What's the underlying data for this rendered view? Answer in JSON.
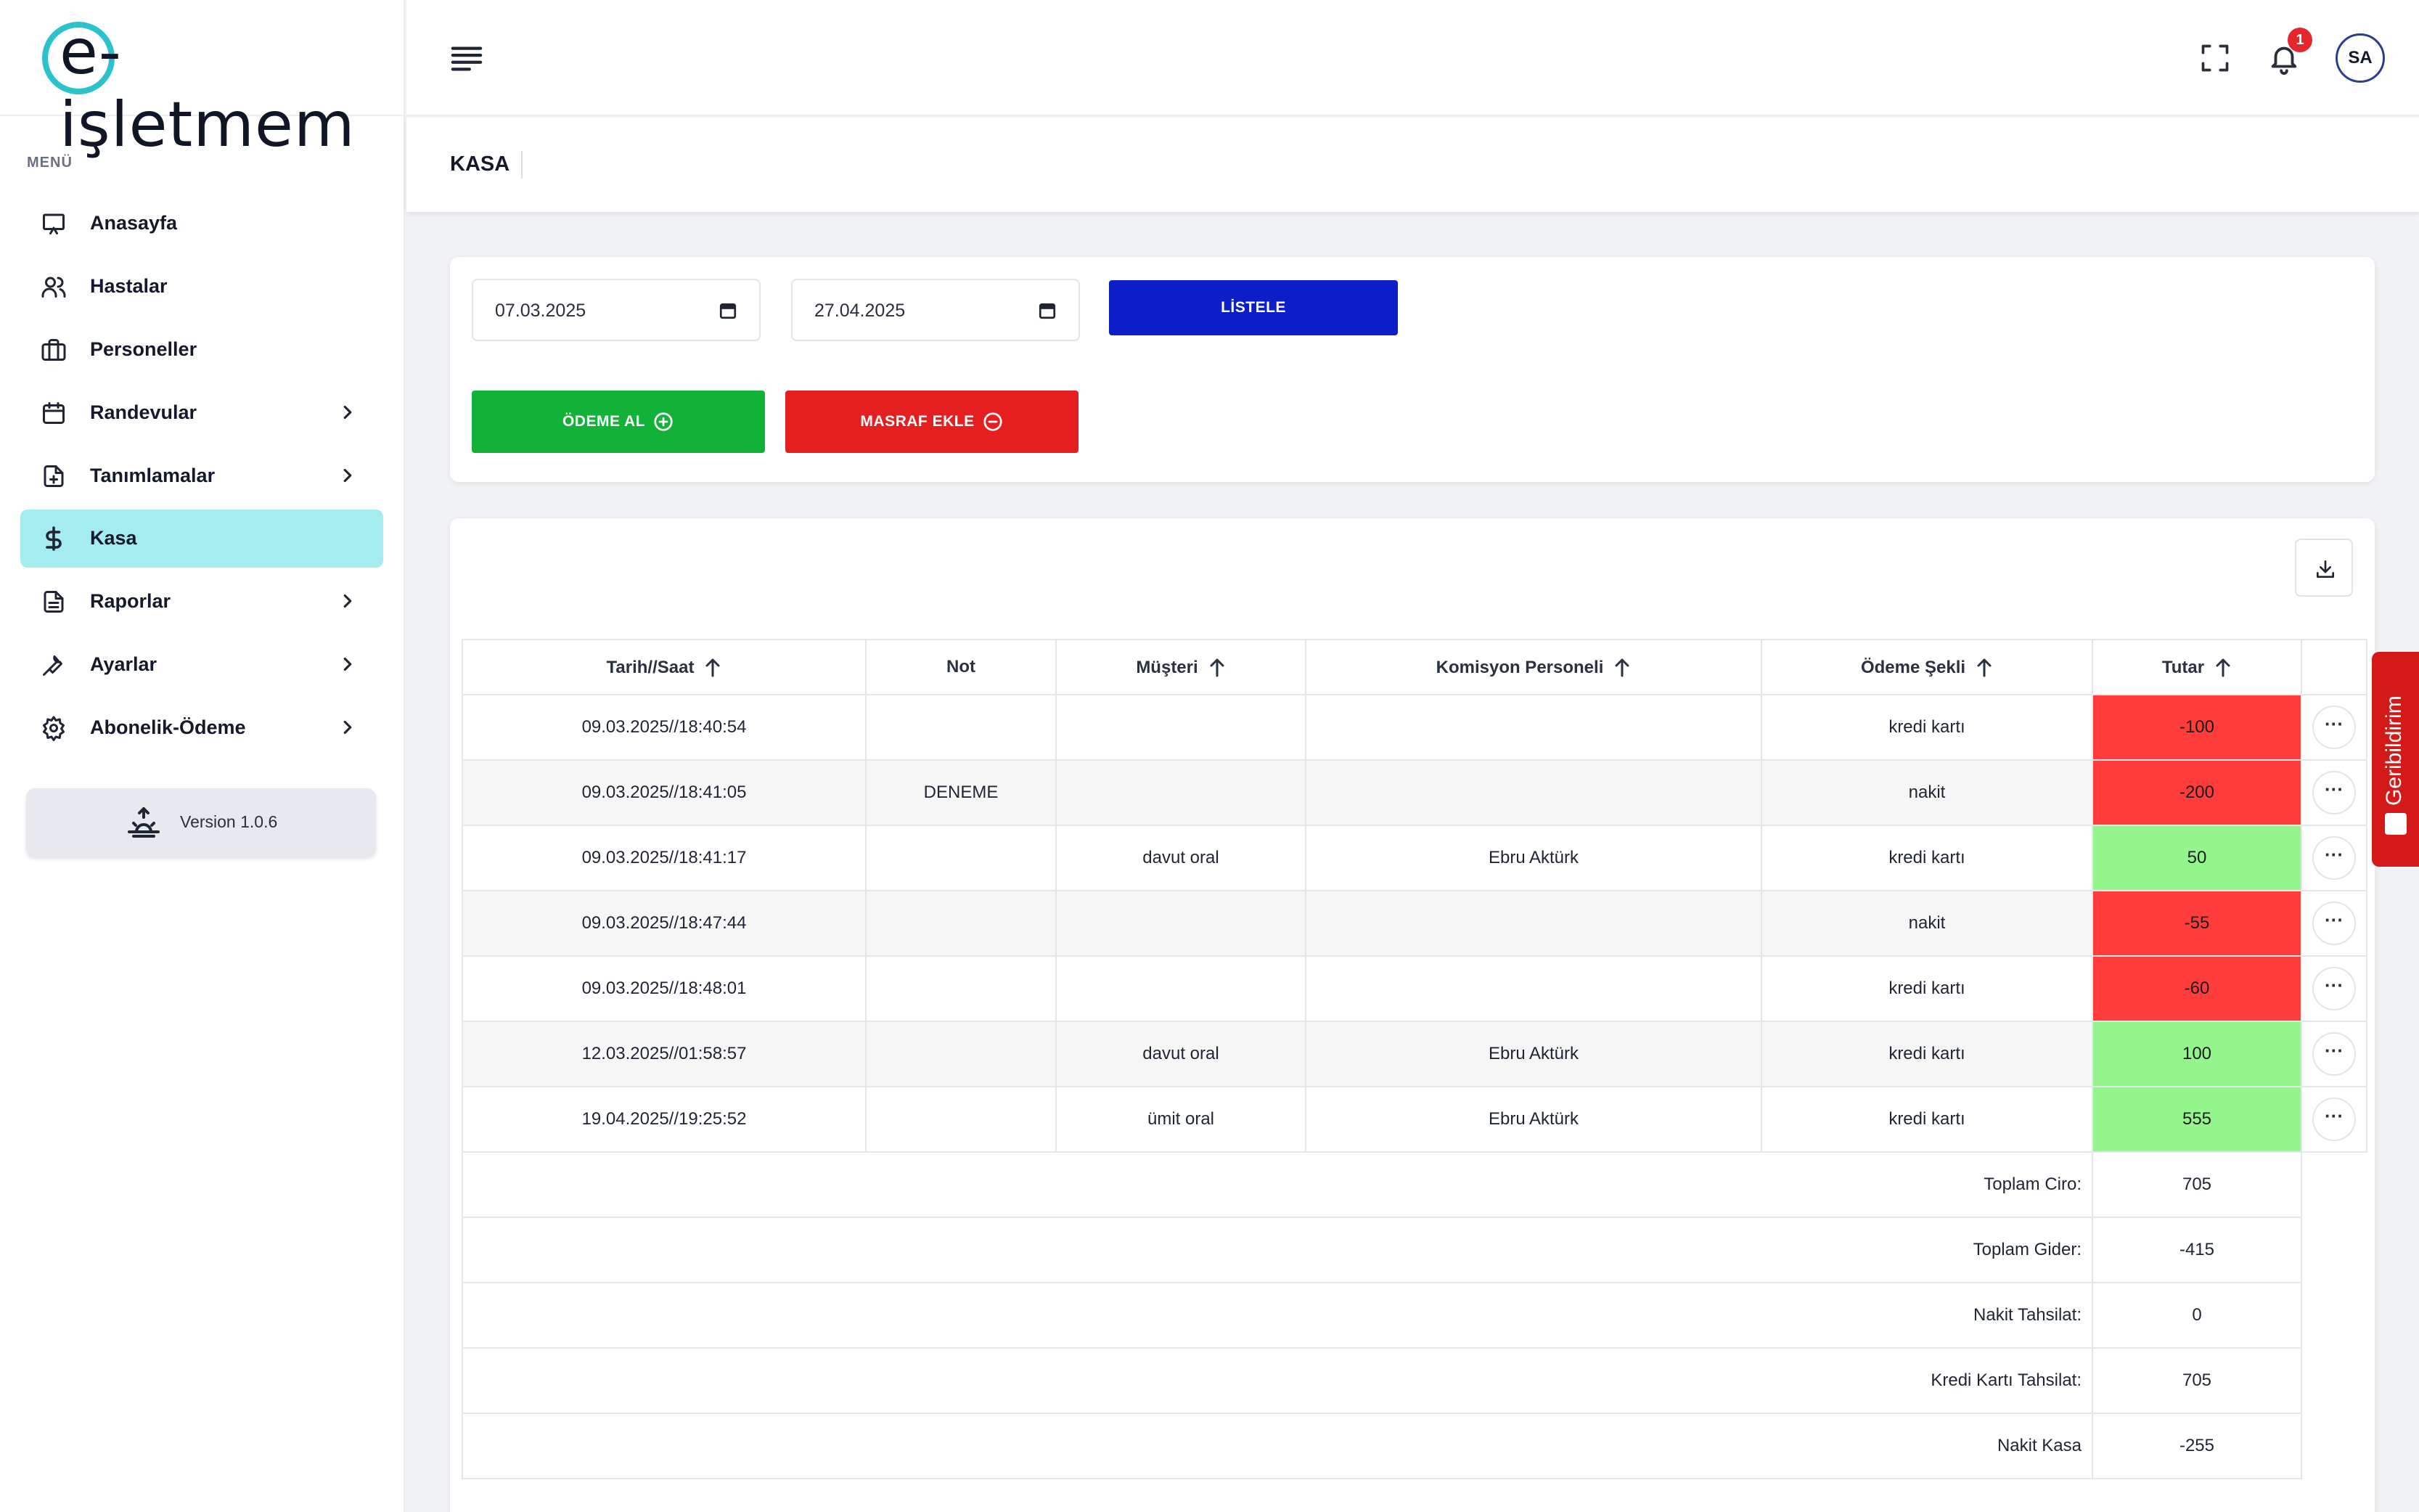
{
  "app": {
    "logo_text": "e-işletmem",
    "brand_color": "#2cc2cc"
  },
  "header": {
    "notification_count": "1",
    "user_initials": "SA"
  },
  "sidebar": {
    "menu_label": "MENÜ",
    "items": [
      {
        "label": "Anasayfa",
        "icon": "monitor-icon",
        "has_submenu": false,
        "active": false
      },
      {
        "label": "Hastalar",
        "icon": "users-icon",
        "has_submenu": false,
        "active": false
      },
      {
        "label": "Personeller",
        "icon": "briefcase-icon",
        "has_submenu": false,
        "active": false
      },
      {
        "label": "Randevular",
        "icon": "calendar-icon",
        "has_submenu": true,
        "active": false
      },
      {
        "label": "Tanımlamalar",
        "icon": "file-plus-icon",
        "has_submenu": true,
        "active": false
      },
      {
        "label": "Kasa",
        "icon": "dollar-icon",
        "has_submenu": false,
        "active": true
      },
      {
        "label": "Raporlar",
        "icon": "document-icon",
        "has_submenu": true,
        "active": false
      },
      {
        "label": "Ayarlar",
        "icon": "wrench-icon",
        "has_submenu": true,
        "active": false
      },
      {
        "label": "Abonelik-Ödeme",
        "icon": "gear-icon",
        "has_submenu": true,
        "active": false
      }
    ],
    "version": "Version 1.0.6"
  },
  "page": {
    "title": "KASA"
  },
  "filters": {
    "start_date": "07.03.2025",
    "end_date": "27.04.2025",
    "list_button": "LİSTELE",
    "payment_button": "ÖDEME AL",
    "expense_button": "MASRAF EKLE"
  },
  "table": {
    "columns": [
      "Tarih//Saat",
      "Not",
      "Müşteri",
      "Komisyon Personeli",
      "Ödeme Şekli",
      "Tutar"
    ],
    "rows": [
      {
        "datetime": "09.03.2025//18:40:54",
        "note": "",
        "customer": "",
        "commission_staff": "",
        "payment_method": "kredi kartı",
        "amount": "-100",
        "sign": "neg"
      },
      {
        "datetime": "09.03.2025//18:41:05",
        "note": "DENEME",
        "customer": "",
        "commission_staff": "",
        "payment_method": "nakit",
        "amount": "-200",
        "sign": "neg"
      },
      {
        "datetime": "09.03.2025//18:41:17",
        "note": "",
        "customer": "davut oral",
        "commission_staff": "Ebru Aktürk",
        "payment_method": "kredi kartı",
        "amount": "50",
        "sign": "pos"
      },
      {
        "datetime": "09.03.2025//18:47:44",
        "note": "",
        "customer": "",
        "commission_staff": "",
        "payment_method": "nakit",
        "amount": "-55",
        "sign": "neg"
      },
      {
        "datetime": "09.03.2025//18:48:01",
        "note": "",
        "customer": "",
        "commission_staff": "",
        "payment_method": "kredi kartı",
        "amount": "-60",
        "sign": "neg"
      },
      {
        "datetime": "12.03.2025//01:58:57",
        "note": "",
        "customer": "davut oral",
        "commission_staff": "Ebru Aktürk",
        "payment_method": "kredi kartı",
        "amount": "100",
        "sign": "pos"
      },
      {
        "datetime": "19.04.2025//19:25:52",
        "note": "",
        "customer": "ümit oral",
        "commission_staff": "Ebru Aktürk",
        "payment_method": "kredi kartı",
        "amount": "555",
        "sign": "pos"
      }
    ],
    "action_glyph": "···",
    "summary": [
      {
        "label": "Toplam Ciro:",
        "value": "705"
      },
      {
        "label": "Toplam Gider:",
        "value": "-415"
      },
      {
        "label": "Nakit Tahsilat:",
        "value": "0"
      },
      {
        "label": "Kredi Kartı Tahsilat:",
        "value": "705"
      },
      {
        "label": "Nakit Kasa",
        "value": "-255"
      }
    ]
  },
  "feedback": {
    "label": "Geribildirim"
  },
  "colors": {
    "negative": "#ff3c3c",
    "positive": "#94f58d",
    "primary_button": "#0b1ec8",
    "success_button": "#12b238",
    "danger_button": "#e51f1f"
  }
}
